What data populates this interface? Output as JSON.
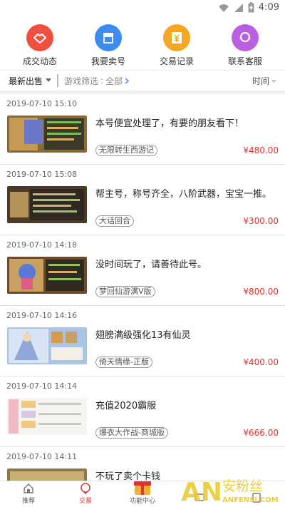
{
  "status_bar": {
    "time": "4:09"
  },
  "quick_actions": [
    {
      "label": "成交动态",
      "color": "#f04e3e",
      "icon": "handshake-icon"
    },
    {
      "label": "我要卖号",
      "color": "#3d8cf2",
      "icon": "shop-icon"
    },
    {
      "label": "交易记录",
      "color": "#f5a623",
      "icon": "yen-doc-icon"
    },
    {
      "label": "联系客服",
      "color": "#b95fe0",
      "icon": "support-icon"
    }
  ],
  "filter": {
    "latest_label": "最新出售",
    "game_filter_label": "游戏筛选",
    "game_filter_value": "全部",
    "sort_label": "时间"
  },
  "listings": [
    {
      "date": "2019-07-10 15:10",
      "title": "本号便宜处理了，有要的朋友看下！",
      "tag": "无限转生西游记",
      "price": "¥480.00"
    },
    {
      "date": "2019-07-10 15:08",
      "title": "帮主号，称号齐全，八阶武器，宝宝一推。",
      "tag": "大话回合",
      "price": "¥300.00"
    },
    {
      "date": "2019-07-10 14:18",
      "title": "没时间玩了，请善待此号。",
      "tag": "梦回仙游满V版",
      "price": "¥800.00"
    },
    {
      "date": "2019-07-10 14:16",
      "title": "翅膀满级强化13有仙灵",
      "tag": "倚天情缘-正版",
      "price": "¥400.00"
    },
    {
      "date": "2019-07-10 14:14",
      "title": "充值2020霸服",
      "tag": "爆衣大作战-商城版",
      "price": "¥666.00"
    },
    {
      "date": "2019-07-10 14:11",
      "title": "不玩了卖个卡钱",
      "tag": "",
      "price": ""
    }
  ],
  "tabs": [
    {
      "label": "推荐",
      "icon": "home-icon",
      "active": false
    },
    {
      "label": "交易",
      "icon": "trade-icon",
      "active": true
    },
    {
      "label": "功能中心",
      "icon": "gift-box-icon",
      "active": false
    },
    {
      "label": "",
      "icon": "message-icon",
      "active": false
    },
    {
      "label": "",
      "icon": "profile-icon",
      "active": false
    }
  ],
  "watermark": {
    "text_cn": "安粉丝",
    "text_en": "ANFENSI.COM",
    "logo": "AN"
  },
  "colors": {
    "accent": "#e0322e",
    "watermark_green": "#e8c928"
  }
}
